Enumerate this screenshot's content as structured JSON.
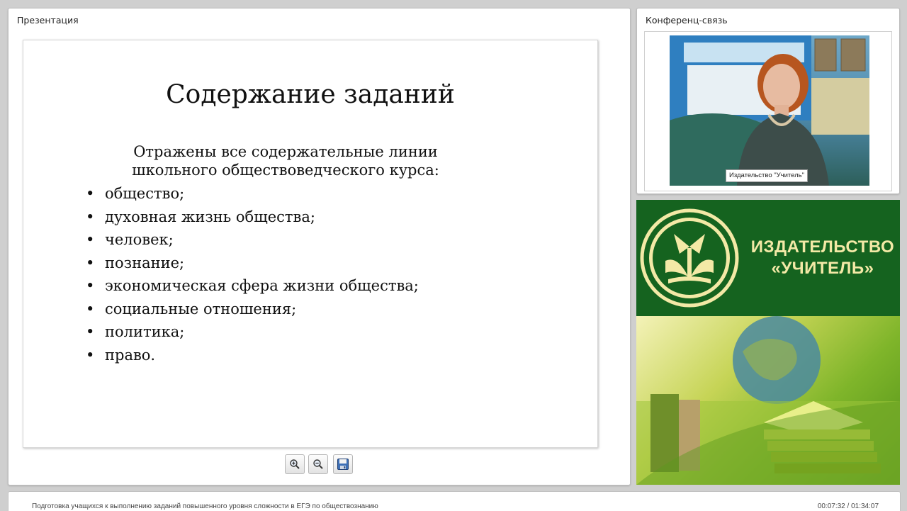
{
  "presentation": {
    "panel_title": "Презентация",
    "slide": {
      "title": "Содержание заданий",
      "intro_line1": "Отражены все содержательные линии",
      "intro_line2": "школьного обществоведческого курса:",
      "bullets": [
        "общество;",
        "духовная жизнь общества;",
        "человек;",
        "познание;",
        "экономическая сфера жизни общества;",
        "социальные отношения;",
        "политика;",
        "право."
      ]
    },
    "toolbar": {
      "zoom_in_icon": "zoom-in-icon",
      "zoom_out_icon": "zoom-out-icon",
      "save_icon": "save-icon"
    }
  },
  "conference": {
    "panel_title": "Конференц-связь",
    "video_caption": "Издательство \"Учитель\""
  },
  "publisher": {
    "line1": "ИЗДАТЕЛЬСТВО",
    "line2": "«УЧИТЕЛЬ»",
    "brand_green": "#15631f",
    "brand_gold": "#f3e9a6"
  },
  "footer": {
    "title": "Подготовка учащихся к выполнению заданий повышенного уровня сложности в ЕГЭ по обществознанию",
    "time": "00:07:32 / 01:34:07"
  }
}
